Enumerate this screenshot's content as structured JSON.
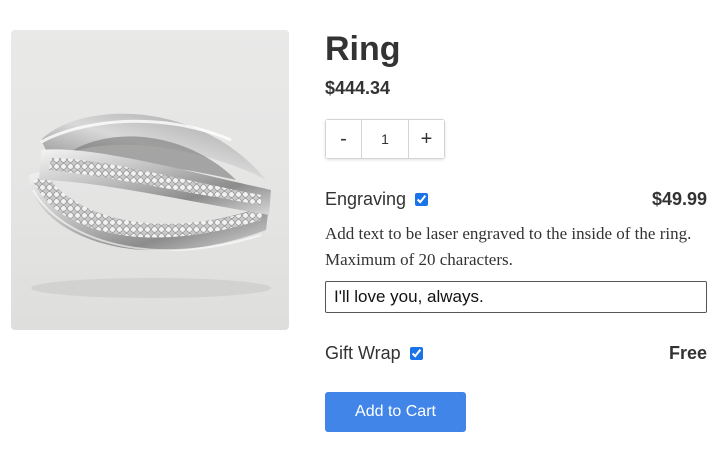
{
  "product": {
    "title": "Ring",
    "price": "$444.34",
    "image_alt": "ring-photo"
  },
  "quantity": {
    "decrement_label": "-",
    "value": "1",
    "increment_label": "+"
  },
  "engraving": {
    "label": "Engraving",
    "checked": true,
    "price": "$49.99",
    "description": "Add text to be laser engraved to the inside of the ring. Maximum of 20 characters.",
    "input_value": "I'll love you, always."
  },
  "gift_wrap": {
    "label": "Gift Wrap",
    "checked": true,
    "price": "Free"
  },
  "cart": {
    "add_label": "Add to Cart"
  },
  "colors": {
    "accent": "#4285e8",
    "text": "#333333",
    "image_bg": "#e6e6e5"
  }
}
